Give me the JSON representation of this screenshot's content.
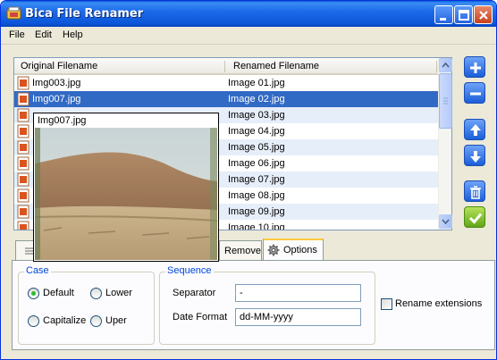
{
  "window": {
    "title": "Bica File Renamer"
  },
  "menu": [
    "File",
    "Edit",
    "Help"
  ],
  "list": {
    "headers": {
      "original": "Original Filename",
      "renamed": "Renamed Filename"
    },
    "rows": [
      {
        "original": "Img003.jpg",
        "renamed": "Image 01.jpg"
      },
      {
        "original": "Img007.jpg",
        "renamed": "Image 02.jpg"
      },
      {
        "original": "",
        "renamed": "Image 03.jpg"
      },
      {
        "original": "",
        "renamed": "Image 04.jpg"
      },
      {
        "original": "",
        "renamed": "Image 05.jpg"
      },
      {
        "original": "",
        "renamed": "Image 06.jpg"
      },
      {
        "original": "",
        "renamed": "Image 07.jpg"
      },
      {
        "original": "",
        "renamed": "Image 08.jpg"
      },
      {
        "original": "",
        "renamed": "Image 09.jpg"
      },
      {
        "original": "",
        "renamed": "Image 10.jpg"
      }
    ]
  },
  "preview": {
    "filename": "Img007.jpg"
  },
  "side_buttons": [
    {
      "icon": "plus-icon",
      "color": "#1b5ed8"
    },
    {
      "icon": "minus-icon",
      "color": "#1b5ed8"
    },
    {
      "icon": "arrow-up-icon",
      "color": "#1b5ed8"
    },
    {
      "icon": "arrow-down-icon",
      "color": "#1b5ed8"
    },
    {
      "icon": "trash-icon",
      "color": "#1b5ed8"
    },
    {
      "icon": "checkmark-icon",
      "color": "#62a516"
    }
  ],
  "tabs": {
    "remove": "Remove",
    "options": "Options"
  },
  "case": {
    "title": "Case",
    "default": "Default",
    "lower": "Lower",
    "capitalize": "Capitalize",
    "upper": "Uper",
    "selected": "Default"
  },
  "sequence": {
    "title": "Sequence",
    "separator_label": "Separator",
    "separator_value": "-",
    "date_format_label": "Date Format",
    "date_format_value": "dd-MM-yyyy"
  },
  "rename_extensions": {
    "label": "Rename extensions",
    "checked": false
  }
}
